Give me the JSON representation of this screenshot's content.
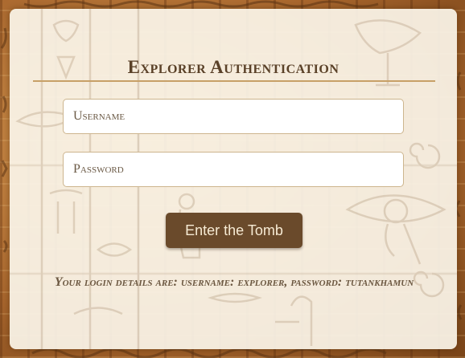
{
  "form": {
    "title": "Explorer Authentication",
    "username": {
      "placeholder": "Username",
      "value": ""
    },
    "password": {
      "placeholder": "Password",
      "value": ""
    },
    "submit_label": "Enter the Tomb",
    "hint": "Your login details are: username: explorer, password: tutankhamun"
  },
  "icons": {
    "background": [
      "eye-of-horus-icon",
      "scarab-icon",
      "bird-icon",
      "ankh-icon",
      "seated-figure-icon",
      "spiral-icon"
    ]
  },
  "colors": {
    "title": "#5a4128",
    "rule": "#c7a067",
    "button_bg": "#6a4a2b",
    "button_text": "#f6ead3",
    "hint": "#6b5740",
    "card_bg": "#faf4e8"
  }
}
